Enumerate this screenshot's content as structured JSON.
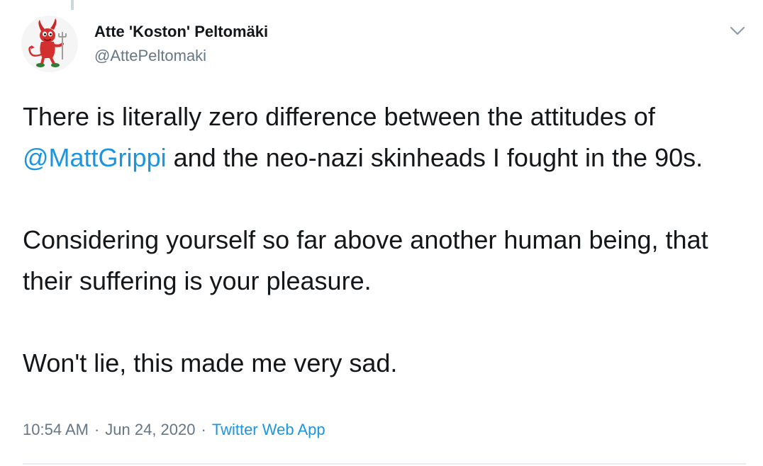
{
  "author": {
    "display_name": "Atte 'Koston' Peltomäki",
    "handle": "@AttePeltomaki",
    "avatar_icon": "bsd-daemon-avatar"
  },
  "tweet": {
    "line1_before": "There is literally zero difference between the attitudes of ",
    "mention": "@MattGrippi",
    "line1_after": " and the neo-nazi skinheads I fought in the 90s.",
    "paragraph2": "Considering yourself so far above another human being, that their suffering is your pleasure.",
    "paragraph3": "Won't lie, this made me very sad."
  },
  "meta": {
    "time": "10:54 AM",
    "separator": "·",
    "date": "Jun 24, 2020",
    "source": "Twitter Web App"
  },
  "colors": {
    "link": "#1b95e0",
    "secondary": "#657786",
    "text": "#14171a"
  },
  "icons": {
    "more": "chevron-down-icon"
  }
}
